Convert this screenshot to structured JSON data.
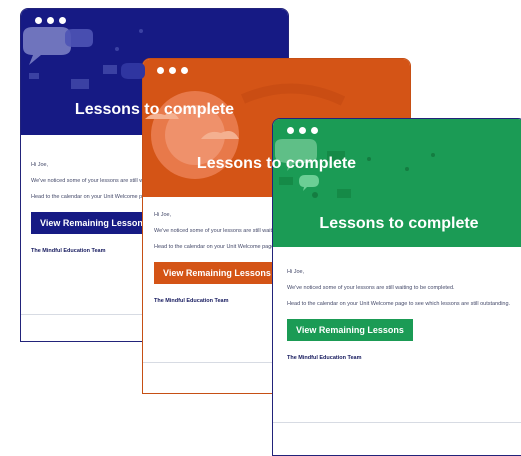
{
  "cards": [
    {
      "hero_title": "Lessons to complete",
      "greeting": "Hi Joe,",
      "line1": "We've noticed some of your lessons are still waiting to be completed.",
      "line2": "Head to the calendar on your Unit Welcome page to see which lessons are still outstanding.",
      "button": "View Remaining Lessons",
      "signature": "The Mindful Education Team",
      "accent": "#161a84"
    },
    {
      "hero_title": "Lessons to complete",
      "greeting": "Hi Joe,",
      "line1": "We've noticed some of your lessons are still waiting to be completed.",
      "line2": "Head to the calendar on your Unit Welcome page to see which lessons are still outstanding.",
      "button": "View Remaining Lessons",
      "signature": "The Mindful Education Team",
      "accent": "#d45416"
    },
    {
      "hero_title": "Lessons to complete",
      "greeting": "Hi Joe,",
      "line1": "We've noticed some of your lessons are still waiting to be completed.",
      "line2": "Head to the calendar on your Unit Welcome page to see which lessons are still outstanding.",
      "button": "View Remaining Lessons",
      "signature": "The Mindful Education Team",
      "accent": "#1b9b55"
    }
  ]
}
